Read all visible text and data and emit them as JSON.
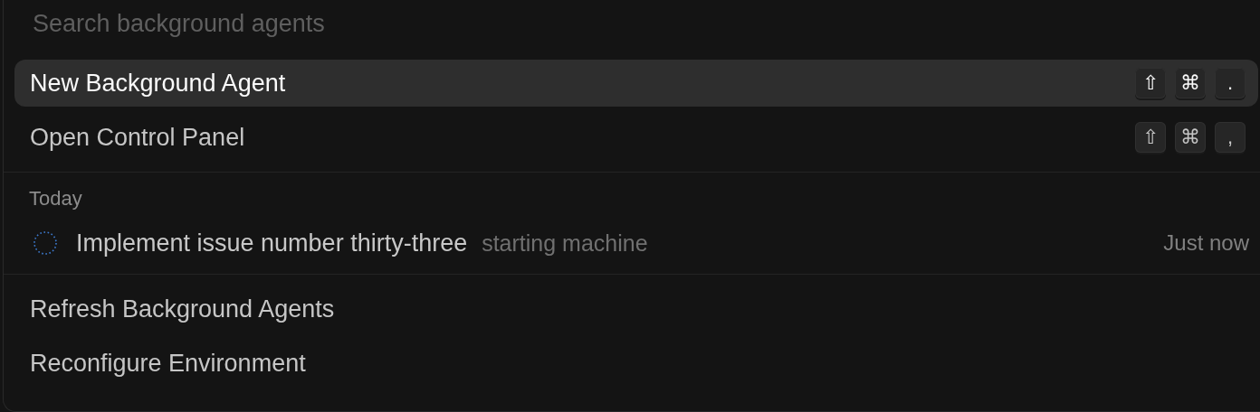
{
  "search": {
    "placeholder": "Search background agents"
  },
  "actions": [
    {
      "label": "New Background Agent",
      "selected": true,
      "shortcut": [
        "⇧",
        "⌘",
        "."
      ]
    },
    {
      "label": "Open Control Panel",
      "selected": false,
      "shortcut": [
        "⇧",
        "⌘",
        ","
      ]
    }
  ],
  "sections": [
    {
      "heading": "Today",
      "agents": [
        {
          "title": "Implement issue number thirty-three",
          "status": "starting machine",
          "time": "Just now"
        }
      ]
    }
  ],
  "footer_actions": [
    {
      "label": "Refresh Background Agents",
      "selected": false
    },
    {
      "label": "Reconfigure Environment",
      "selected": false
    }
  ]
}
